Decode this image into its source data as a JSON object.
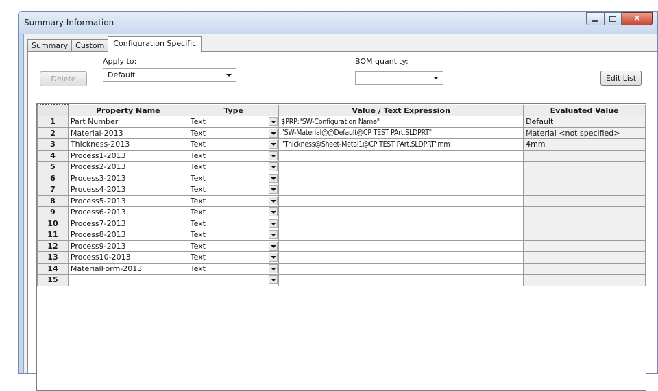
{
  "window": {
    "title": "Summary Information"
  },
  "tabs": [
    "Summary",
    "Custom",
    "Configuration Specific"
  ],
  "toolbar": {
    "delete_label": "Delete",
    "apply_to_label": "Apply to:",
    "apply_to_value": "Default",
    "bom_label": "BOM quantity:",
    "bom_value": "",
    "edit_list_label": "Edit List"
  },
  "grid": {
    "headers": [
      "Property Name",
      "Type",
      "Value / Text Expression",
      "Evaluated Value"
    ],
    "rows": [
      {
        "num": "1",
        "name": "Part Number",
        "type": "Text",
        "value": "$PRP:\"SW-Configuration Name\"",
        "eval": "Default"
      },
      {
        "num": "2",
        "name": "Material-2013",
        "type": "Text",
        "value": "\"SW-Material@@Default@CP TEST PArt.SLDPRT\"",
        "eval": "Material <not specified>"
      },
      {
        "num": "3",
        "name": "Thickness-2013",
        "type": "Text",
        "value": "\"Thickness@Sheet-Metal1@CP TEST PArt.SLDPRT\"mm",
        "eval": "4mm"
      },
      {
        "num": "4",
        "name": "Process1-2013",
        "type": "Text",
        "value": "",
        "eval": ""
      },
      {
        "num": "5",
        "name": "Process2-2013",
        "type": "Text",
        "value": "",
        "eval": ""
      },
      {
        "num": "6",
        "name": "Process3-2013",
        "type": "Text",
        "value": "",
        "eval": ""
      },
      {
        "num": "7",
        "name": "Process4-2013",
        "type": "Text",
        "value": "",
        "eval": ""
      },
      {
        "num": "8",
        "name": "Process5-2013",
        "type": "Text",
        "value": "",
        "eval": ""
      },
      {
        "num": "9",
        "name": "Process6-2013",
        "type": "Text",
        "value": "",
        "eval": ""
      },
      {
        "num": "10",
        "name": "Process7-2013",
        "type": "Text",
        "value": "",
        "eval": ""
      },
      {
        "num": "11",
        "name": "Process8-2013",
        "type": "Text",
        "value": "",
        "eval": ""
      },
      {
        "num": "12",
        "name": "Process9-2013",
        "type": "Text",
        "value": "",
        "eval": ""
      },
      {
        "num": "13",
        "name": "Process10-2013",
        "type": "Text",
        "value": "",
        "eval": ""
      },
      {
        "num": "14",
        "name": "MaterialForm-2013",
        "type": "Text",
        "value": "",
        "eval": ""
      },
      {
        "num": "15",
        "name": "",
        "type": "",
        "value": "",
        "eval": ""
      }
    ]
  },
  "icons": {
    "minimize": "minimize-icon",
    "maximize": "maximize-icon",
    "close": "close-icon",
    "dropdown": "chevron-down-icon"
  }
}
